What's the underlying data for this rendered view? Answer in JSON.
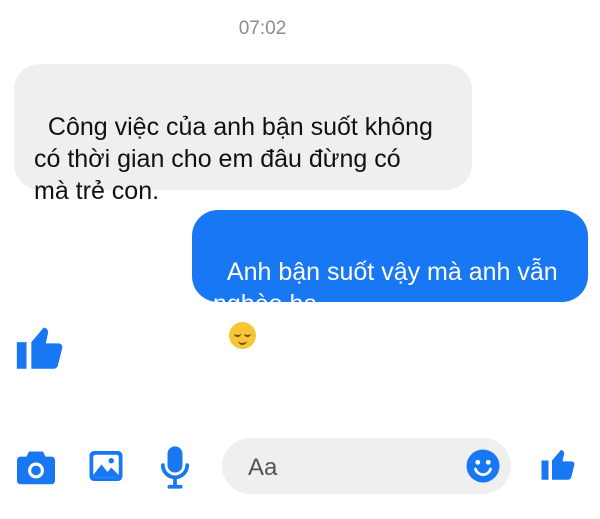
{
  "conversation": {
    "timestamp": "07:02",
    "messages": [
      {
        "direction": "incoming",
        "text": "Công việc của anh bận suốt không\ncó thời gian cho em đâu đừng có\nmà trẻ con."
      },
      {
        "direction": "outgoing",
        "text": "Anh bận suốt vậy mà anh vẫn\nnghèo ha",
        "emoji": "relieved-face"
      },
      {
        "direction": "outgoing",
        "sticker": "thumbs-up-icon"
      }
    ]
  },
  "composer": {
    "placeholder": "Aa",
    "tools": [
      "camera-icon",
      "image-icon",
      "microphone-icon"
    ],
    "emoji_button": "smiley-icon",
    "send_button": "thumbs-up-icon"
  },
  "colors": {
    "accent": "#1877f2",
    "incoming_bubble": "#efefef",
    "timestamp": "#8a8d91"
  }
}
